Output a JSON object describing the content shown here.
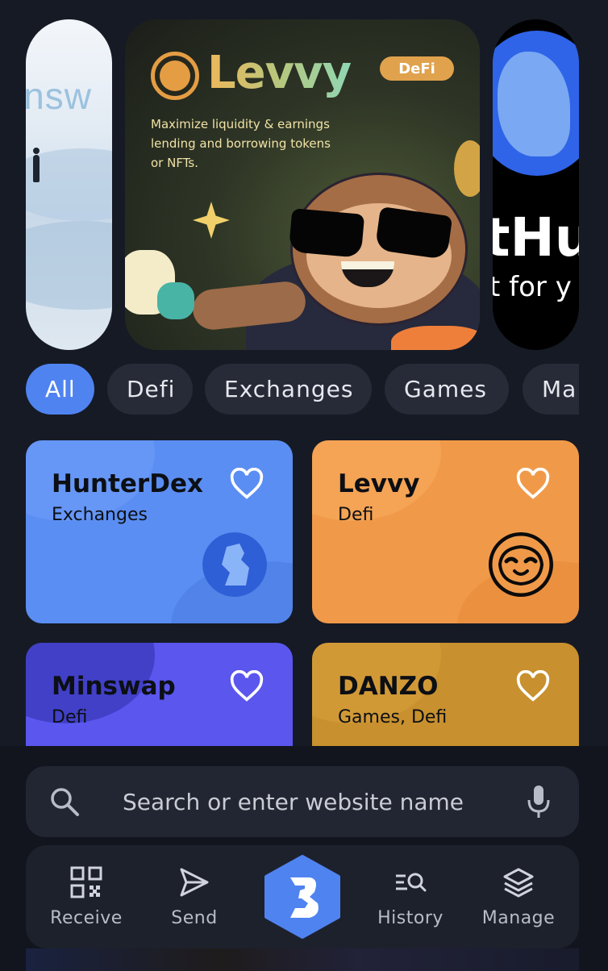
{
  "banners": {
    "left": {
      "watermark": "insw"
    },
    "main": {
      "logo_text": "Levvy",
      "tag": "DeFi",
      "description": "Maximize liquidity & earnings lending and borrowing tokens or NFTs."
    },
    "right": {
      "watermark_line1": "tHu",
      "watermark_line2": "t for y"
    }
  },
  "categories": [
    "All",
    "Defi",
    "Exchanges",
    "Games",
    "Ma"
  ],
  "active_category": "All",
  "cards": [
    {
      "name": "HunterDex",
      "category": "Exchanges",
      "color": "#5b8ef2",
      "favorite_icon": "heart-outline-icon"
    },
    {
      "name": "Levvy",
      "category": "Defi",
      "color": "#f09a49",
      "favorite_icon": "heart-outline-icon"
    },
    {
      "name": "Minswap",
      "category": "Defi",
      "color": "#5a56ee",
      "favorite_icon": "heart-outline-icon"
    },
    {
      "name": "DANZO",
      "category": "Games, Defi",
      "color": "#c8902e",
      "favorite_icon": "heart-outline-icon"
    }
  ],
  "search": {
    "placeholder": "Search or enter website name",
    "icon": "search-icon",
    "voice_icon": "mic-icon"
  },
  "nav": {
    "receive": "Receive",
    "send": "Send",
    "center_icon": "brand-logo-icon",
    "history": "History",
    "manage": "Manage"
  },
  "colors": {
    "background": "#161a25",
    "accent": "#4f83f0",
    "chip": "#272b37",
    "levvy_tag": "#e0a24d"
  }
}
